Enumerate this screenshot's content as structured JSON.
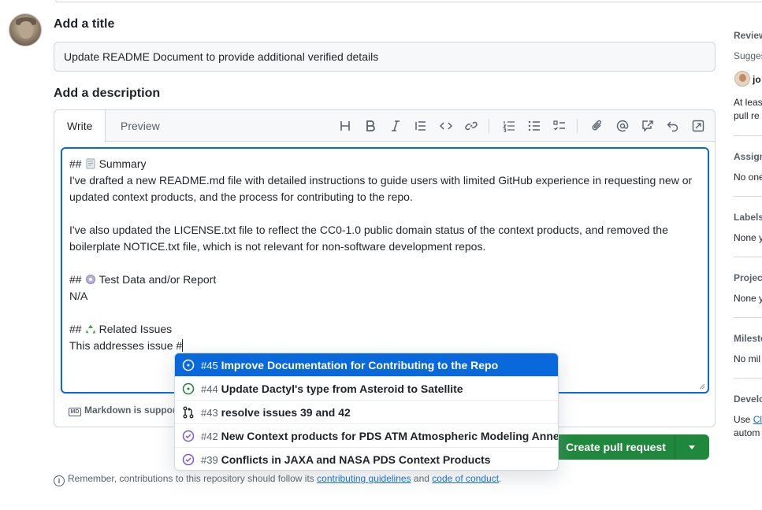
{
  "form": {
    "title_heading": "Add a title",
    "title_value": "Update README Document to provide additional verified details",
    "description_heading": "Add a description"
  },
  "editor": {
    "tabs": {
      "write": "Write",
      "preview": "Preview"
    },
    "toolbar_icons": [
      "heading-icon",
      "bold-icon",
      "italic-icon",
      "quote-icon",
      "code-icon",
      "link-icon",
      "numbered-list-icon",
      "unordered-list-icon",
      "task-list-icon",
      "attach-icon",
      "mention-icon",
      "reference-icon",
      "undo-icon",
      "fullscreen-icon"
    ],
    "body": {
      "summary_prefix": "##",
      "summary_heading": "Summary",
      "summary_text": "I've drafted a new README.md file with detailed instructions to guide users with limited GitHub experience in requesting new or updated context products, and the process for contributing to the repo.",
      "license_text": "I've also updated the LICENSE.txt file to reflect the CC0-1.0 public domain status of the context products, and removed the boilerplate NOTICE.txt file, which is not relevant for non-software development repos.",
      "test_prefix": "##",
      "test_heading": "Test Data and/or Report",
      "test_text": "N/A",
      "related_prefix": "##",
      "related_heading": "Related Issues",
      "related_text": "This addresses issue #"
    },
    "footer": "Markdown is support",
    "footer_badge": "MD"
  },
  "suggestions": [
    {
      "number": "#45",
      "title": "Improve Documentation for Contributing to the Repo",
      "icon": "issue-open-icon",
      "selected": true
    },
    {
      "number": "#44",
      "title": "Update Dactyl's type from Asteroid to Satellite",
      "icon": "issue-open-icon",
      "selected": false
    },
    {
      "number": "#43",
      "title": "resolve issues 39 and 42",
      "icon": "pull-request-icon",
      "selected": false
    },
    {
      "number": "#42",
      "title": "New Context products for PDS ATM Atmospheric Modeling Annex",
      "icon": "issue-closed-icon",
      "selected": false
    },
    {
      "number": "#39",
      "title": "Conflicts in JAXA and NASA PDS Context Products",
      "icon": "issue-closed-icon",
      "selected": false
    }
  ],
  "create_button": {
    "label": "Create pull request"
  },
  "remember": {
    "prefix": "Remember, contributions to this repository should follow its",
    "link1": "contributing guidelines",
    "and": "and",
    "link2": "code of conduct",
    "suffix": "."
  },
  "sidebar": {
    "reviewers_title": "Review",
    "suggestions_label": "Sugges",
    "reviewer_name": "jo",
    "reviewer_note_1": "At leas",
    "reviewer_note_2": "pull re",
    "assignees_title": "Assign",
    "assignees_value": "No one",
    "labels_title": "Labels",
    "labels_value": "None y",
    "projects_title": "Project",
    "projects_value": "None y",
    "milestone_title": "Milesto",
    "milestone_value": "No mil",
    "development_title": "Develo",
    "development_value_prefix": "Use",
    "development_link": "Clo",
    "development_value_2": "autom"
  },
  "colors": {
    "accent": "#0969da",
    "success": "#1f883d",
    "issue_open": "#1a7f37",
    "issue_closed": "#8250df",
    "border": "#d0d7de",
    "muted": "#57606a"
  }
}
